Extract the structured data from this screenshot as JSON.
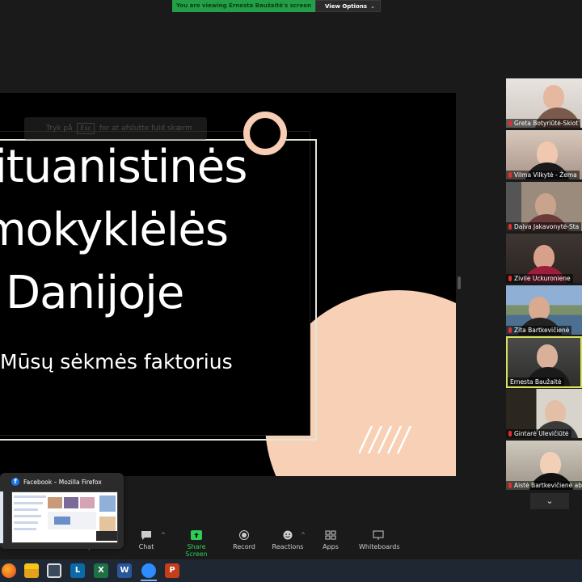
{
  "banner": {
    "message": "You are viewing Ernesta Baužaitė's screen",
    "view_options": "View Options"
  },
  "slide": {
    "esc_hint_pre": "Tryk på",
    "esc_key": "Esc",
    "esc_hint_post": "for at afslutte fuld skærm",
    "title_lines": [
      "Lituanistinės",
      "mokyklėlės",
      "Danijoje"
    ],
    "subtitle": "Mūsų sėkmės faktorius",
    "colors": {
      "peach": "#f8d0b6",
      "frame": "#dfe7d8"
    }
  },
  "participants": [
    {
      "name": "Greta Botyriūtė-Skiot"
    },
    {
      "name": "Vilma Vilkytė - Žema"
    },
    {
      "name": "Daiva Jakavonytė-Sta"
    },
    {
      "name": "Zivile Uckuroniene"
    },
    {
      "name": "Zita Bartkevičienė"
    },
    {
      "name": "Ernesta Baužaitė"
    },
    {
      "name": "Gintarė Ulevičiūtė"
    },
    {
      "name": "Aistė Bartkevičienė abar"
    }
  ],
  "controls": {
    "participants": "Participants",
    "chat": "Chat",
    "share_screen": "Share Screen",
    "record": "Record",
    "reactions": "Reactions",
    "apps": "Apps",
    "whiteboards": "Whiteboards"
  },
  "preview": {
    "title": "Facebook – Mozilla Firefox"
  },
  "taskbar": {
    "apps": [
      "firefox-icon",
      "file-explorer-icon",
      "store-icon",
      "l-app-icon",
      "excel-icon",
      "word-icon",
      "zoom-icon",
      "powerpoint-icon"
    ],
    "letters": {
      "l_app": "L",
      "excel": "X",
      "word": "W",
      "powerpoint": "P"
    }
  }
}
